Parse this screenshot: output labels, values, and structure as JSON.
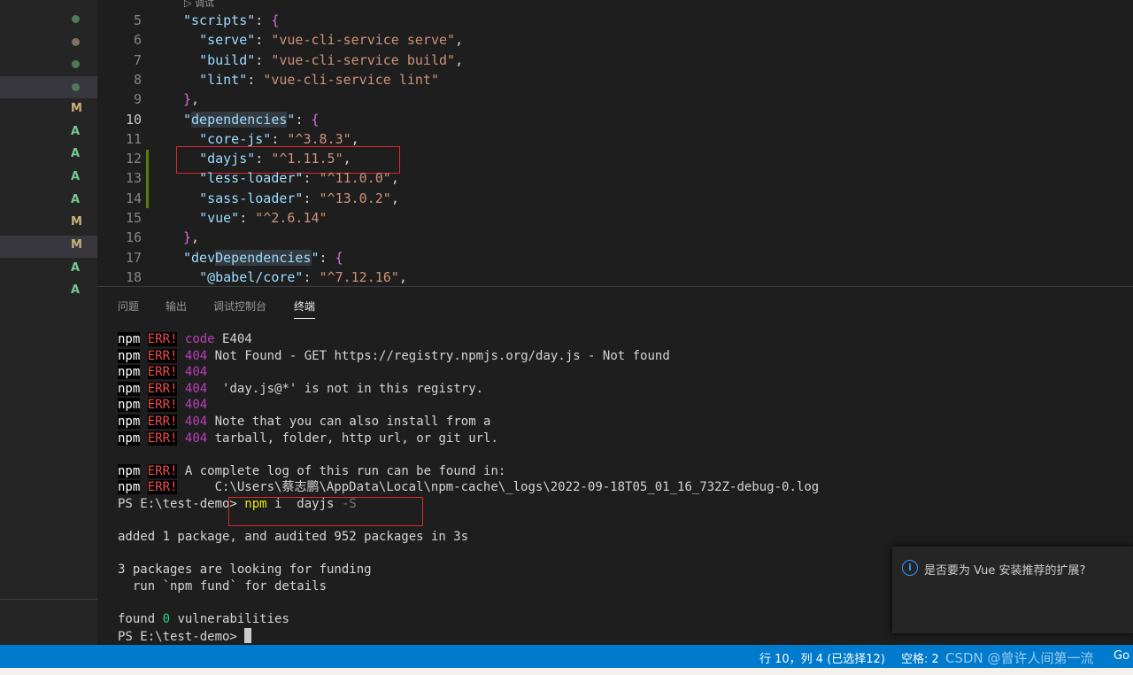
{
  "sidebar": {
    "badges": [
      {
        "type": "dot",
        "color": "#4e7a58"
      },
      {
        "type": "dot",
        "color": "#7d725e"
      },
      {
        "type": "dot",
        "color": "#4e7a58"
      },
      {
        "type": "dot",
        "color": "#4e7a58",
        "selected": true
      },
      {
        "type": "letter",
        "text": "M",
        "color": "#c7b27c"
      },
      {
        "type": "letter",
        "text": "A",
        "color": "#73c991"
      },
      {
        "type": "letter",
        "text": "A",
        "color": "#73c991"
      },
      {
        "type": "letter",
        "text": "A",
        "color": "#73c991"
      },
      {
        "type": "letter",
        "text": "A",
        "color": "#73c991"
      },
      {
        "type": "letter",
        "text": "M",
        "color": "#c7b27c"
      },
      {
        "type": "letter",
        "text": "M",
        "color": "#c7b27c",
        "selected": true
      },
      {
        "type": "letter",
        "text": "A",
        "color": "#73c991"
      },
      {
        "type": "letter",
        "text": "A",
        "color": "#73c991"
      }
    ]
  },
  "editor": {
    "codelens": "▷ 调试",
    "current_line": 10,
    "lines": [
      {
        "n": 5,
        "segs": [
          [
            "k",
            "\"scripts\""
          ],
          [
            "p",
            ": "
          ],
          [
            "b1",
            "{"
          ]
        ]
      },
      {
        "n": 6,
        "segs": [
          [
            "p",
            "  "
          ],
          [
            "k",
            "\"serve\""
          ],
          [
            "p",
            ": "
          ],
          [
            "s",
            "\"vue-cli-service serve\""
          ],
          [
            "p",
            ","
          ]
        ]
      },
      {
        "n": 7,
        "segs": [
          [
            "p",
            "  "
          ],
          [
            "k",
            "\"build\""
          ],
          [
            "p",
            ": "
          ],
          [
            "s",
            "\"vue-cli-service build\""
          ],
          [
            "p",
            ","
          ]
        ]
      },
      {
        "n": 8,
        "segs": [
          [
            "p",
            "  "
          ],
          [
            "k",
            "\"lint\""
          ],
          [
            "p",
            ": "
          ],
          [
            "s",
            "\"vue-cli-service lint\""
          ]
        ]
      },
      {
        "n": 9,
        "segs": [
          [
            "b1",
            "}"
          ],
          [
            "p",
            ","
          ]
        ]
      },
      {
        "n": 10,
        "segs": [
          [
            "k",
            "\""
          ],
          [
            "k hl",
            "dependencies"
          ],
          [
            "k",
            "\""
          ],
          [
            "p",
            ": "
          ],
          [
            "b1",
            "{"
          ]
        ]
      },
      {
        "n": 11,
        "segs": [
          [
            "p",
            "  "
          ],
          [
            "k",
            "\"core-js\""
          ],
          [
            "p",
            ": "
          ],
          [
            "s",
            "\"^3.8.3\""
          ],
          [
            "p",
            ","
          ]
        ]
      },
      {
        "n": 12,
        "segs": [
          [
            "p",
            "  "
          ],
          [
            "k",
            "\"dayjs\""
          ],
          [
            "p",
            ": "
          ],
          [
            "s",
            "\"^1.11.5\""
          ],
          [
            "p",
            ","
          ]
        ]
      },
      {
        "n": 13,
        "segs": [
          [
            "p",
            "  "
          ],
          [
            "k",
            "\"less-loader\""
          ],
          [
            "p",
            ": "
          ],
          [
            "s",
            "\"^11.0.0\""
          ],
          [
            "p",
            ","
          ]
        ]
      },
      {
        "n": 14,
        "segs": [
          [
            "p",
            "  "
          ],
          [
            "k",
            "\"sass-loader\""
          ],
          [
            "p",
            ": "
          ],
          [
            "s",
            "\"^13.0.2\""
          ],
          [
            "p",
            ","
          ]
        ]
      },
      {
        "n": 15,
        "segs": [
          [
            "p",
            "  "
          ],
          [
            "k",
            "\"vue\""
          ],
          [
            "p",
            ": "
          ],
          [
            "s",
            "\"^2.6.14\""
          ]
        ]
      },
      {
        "n": 16,
        "segs": [
          [
            "b1",
            "}"
          ],
          [
            "p",
            ","
          ]
        ]
      },
      {
        "n": 17,
        "segs": [
          [
            "k",
            "\"dev"
          ],
          [
            "k hl",
            "Dependencies"
          ],
          [
            "k",
            "\""
          ],
          [
            "p",
            ": "
          ],
          [
            "b1",
            "{"
          ]
        ]
      },
      {
        "n": 18,
        "segs": [
          [
            "p",
            "  "
          ],
          [
            "k",
            "\"@babel/core\""
          ],
          [
            "p",
            ": "
          ],
          [
            "s",
            "\"^7.12.16\""
          ],
          [
            "p",
            ","
          ]
        ]
      }
    ]
  },
  "panel": {
    "tabs": [
      {
        "label": "问题"
      },
      {
        "label": "输出"
      },
      {
        "label": "调试控制台"
      },
      {
        "label": "终端",
        "active": true
      }
    ],
    "terminal": [
      [
        [
          "npm",
          "npm"
        ],
        [
          "p",
          " "
        ],
        [
          "err",
          "ERR!"
        ],
        [
          "p",
          " "
        ],
        [
          "mag",
          "code"
        ],
        [
          "p",
          " E404"
        ]
      ],
      [
        [
          "npm",
          "npm"
        ],
        [
          "p",
          " "
        ],
        [
          "err",
          "ERR!"
        ],
        [
          "p",
          " "
        ],
        [
          "mag",
          "404"
        ],
        [
          "p",
          " Not Found - GET https://registry.npmjs.org/day.js - Not found"
        ]
      ],
      [
        [
          "npm",
          "npm"
        ],
        [
          "p",
          " "
        ],
        [
          "err",
          "ERR!"
        ],
        [
          "p",
          " "
        ],
        [
          "mag",
          "404"
        ]
      ],
      [
        [
          "npm",
          "npm"
        ],
        [
          "p",
          " "
        ],
        [
          "err",
          "ERR!"
        ],
        [
          "p",
          " "
        ],
        [
          "mag",
          "404"
        ],
        [
          "p",
          "  'day.js@*' is not in this registry."
        ]
      ],
      [
        [
          "npm",
          "npm"
        ],
        [
          "p",
          " "
        ],
        [
          "err",
          "ERR!"
        ],
        [
          "p",
          " "
        ],
        [
          "mag",
          "404"
        ]
      ],
      [
        [
          "npm",
          "npm"
        ],
        [
          "p",
          " "
        ],
        [
          "err",
          "ERR!"
        ],
        [
          "p",
          " "
        ],
        [
          "mag",
          "404"
        ],
        [
          "p",
          " Note that you can also install from a"
        ]
      ],
      [
        [
          "npm",
          "npm"
        ],
        [
          "p",
          " "
        ],
        [
          "err",
          "ERR!"
        ],
        [
          "p",
          " "
        ],
        [
          "mag",
          "404"
        ],
        [
          "p",
          " tarball, folder, http url, or git url."
        ]
      ],
      [],
      [
        [
          "npm",
          "npm"
        ],
        [
          "p",
          " "
        ],
        [
          "err",
          "ERR!"
        ],
        [
          "p",
          " A complete log of this run can be found in:"
        ]
      ],
      [
        [
          "npm",
          "npm"
        ],
        [
          "p",
          " "
        ],
        [
          "err",
          "ERR!"
        ],
        [
          "p",
          "     C:\\Users\\蔡志鹏\\AppData\\Local\\npm-cache\\_logs\\2022-09-18T05_01_16_732Z-debug-0.log"
        ]
      ],
      [
        [
          "p",
          "PS E:\\test-demo> "
        ],
        [
          "yel",
          "npm"
        ],
        [
          "p",
          " i  dayjs "
        ],
        [
          "dim",
          "-S"
        ]
      ],
      [],
      [
        [
          "p",
          "added 1 package, and audited 952 packages in 3s"
        ]
      ],
      [],
      [
        [
          "p",
          "3 packages are looking for funding"
        ]
      ],
      [
        [
          "p",
          "  run `npm fund` for details"
        ]
      ],
      [],
      [
        [
          "p",
          "found "
        ],
        [
          "grn",
          "0"
        ],
        [
          "p",
          " vulnerabilities"
        ]
      ],
      [
        [
          "p",
          "PS E:\\test-demo> "
        ],
        [
          "cursor",
          ""
        ]
      ]
    ]
  },
  "notification": {
    "icon": "info-icon",
    "message": "是否要为 Vue 安装推荐的扩展?"
  },
  "statusbar": {
    "position": "行 10，列 4 (已选择12)",
    "indent": "空格: 2",
    "watermark": "CSDN @曾许人间第一流",
    "trailing": "Go"
  }
}
